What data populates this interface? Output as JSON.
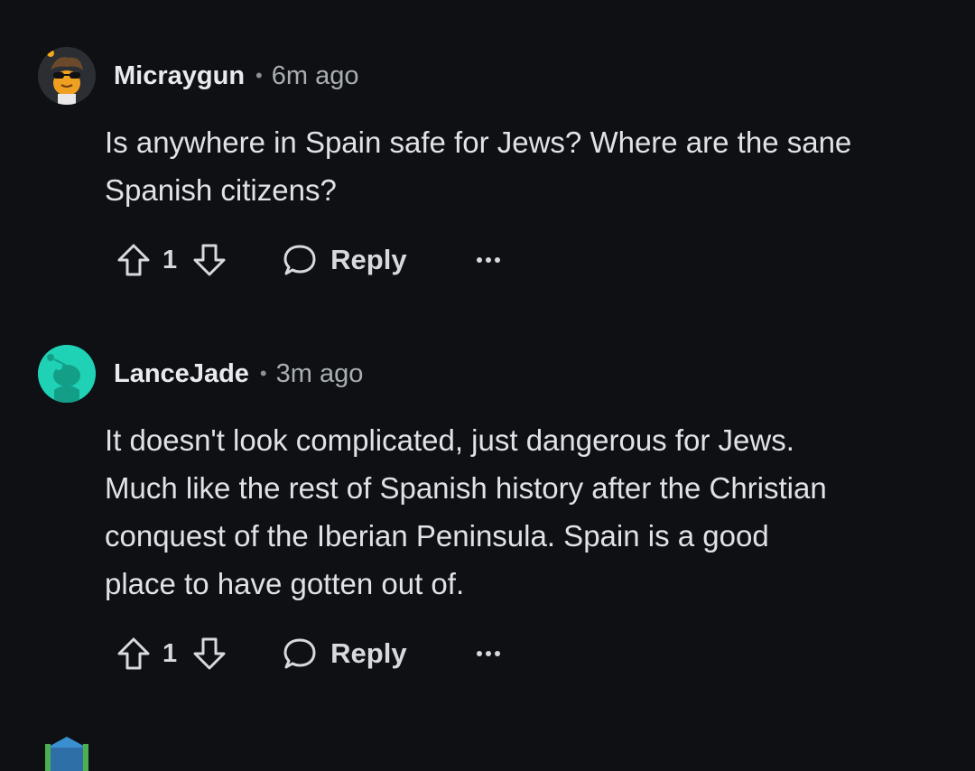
{
  "comments": [
    {
      "author": "Micraygun",
      "separator": "•",
      "time": "6m ago",
      "body_lines": [
        "Is anywhere in Spain safe for Jews? Where are the sane",
        "Spanish citizens?"
      ],
      "score": "1",
      "reply_label": "Reply",
      "avatar_icon": "sunglasses-snoo-avatar"
    },
    {
      "author": "LanceJade",
      "separator": "•",
      "time": "3m ago",
      "body_lines": [
        "It doesn't look complicated, just dangerous for Jews.",
        "Much like the rest of Spanish history after the Christian",
        "conquest of the Iberian Peninsula. Spain is a good",
        "place to have gotten out of."
      ],
      "score": "1",
      "reply_label": "Reply",
      "avatar_icon": "default-snoo-avatar"
    }
  ],
  "colors": {
    "background": "#0e1013",
    "text": "#e0e3e6",
    "muted": "#a8aeb3",
    "avatar_teal": "#1fd1b5"
  }
}
